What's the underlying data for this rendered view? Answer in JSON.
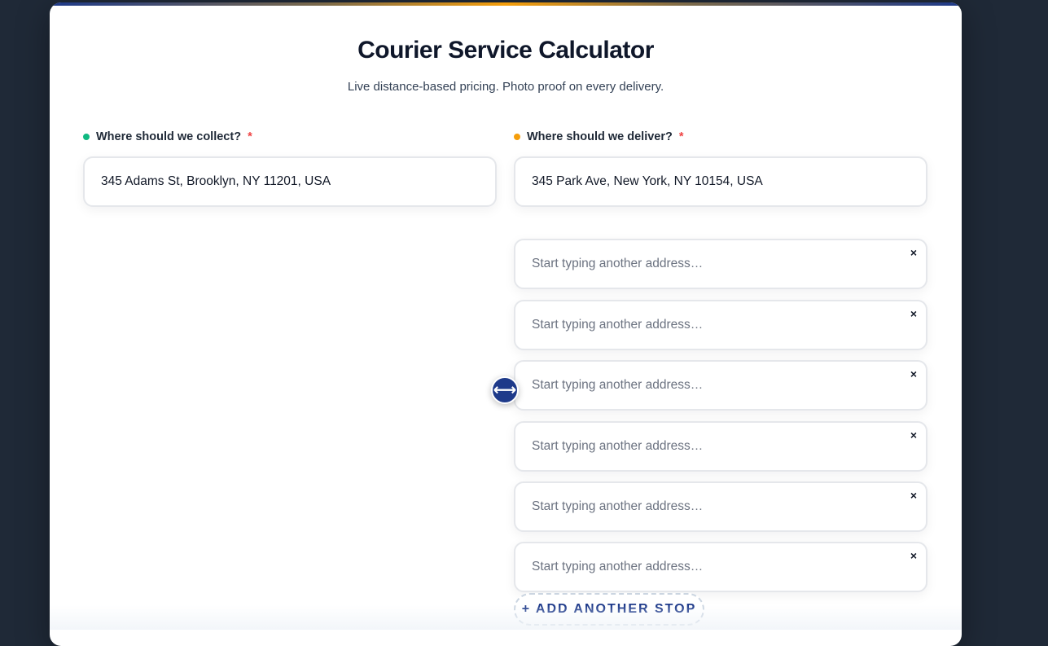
{
  "header": {
    "title": "Courier Service Calculator",
    "subtitle": "Live distance-based pricing. Photo proof on every delivery."
  },
  "pickup": {
    "label": "Where should we collect?",
    "required_mark": "*",
    "value": "345 Adams St, Brooklyn, NY 11201, USA",
    "dot_color": "#10b981"
  },
  "dropoff": {
    "label": "Where should we deliver?",
    "required_mark": "*",
    "value": "345 Park Ave, New York, NY 10154, USA",
    "dot_color": "#f59e0b"
  },
  "stops": [
    {
      "placeholder": "Start typing another address…",
      "remove": "×"
    },
    {
      "placeholder": "Start typing another address…",
      "remove": "×"
    },
    {
      "placeholder": "Start typing another address…",
      "remove": "×"
    },
    {
      "placeholder": "Start typing another address…",
      "remove": "×"
    },
    {
      "placeholder": "Start typing another address…",
      "remove": "×"
    },
    {
      "placeholder": "Start typing another address…",
      "remove": "×"
    }
  ],
  "swap_icon": "⟷",
  "add_stop_label": "+ ADD ANOTHER STOP",
  "colors": {
    "accent": "#1e3a8a",
    "required": "#ef4444"
  }
}
